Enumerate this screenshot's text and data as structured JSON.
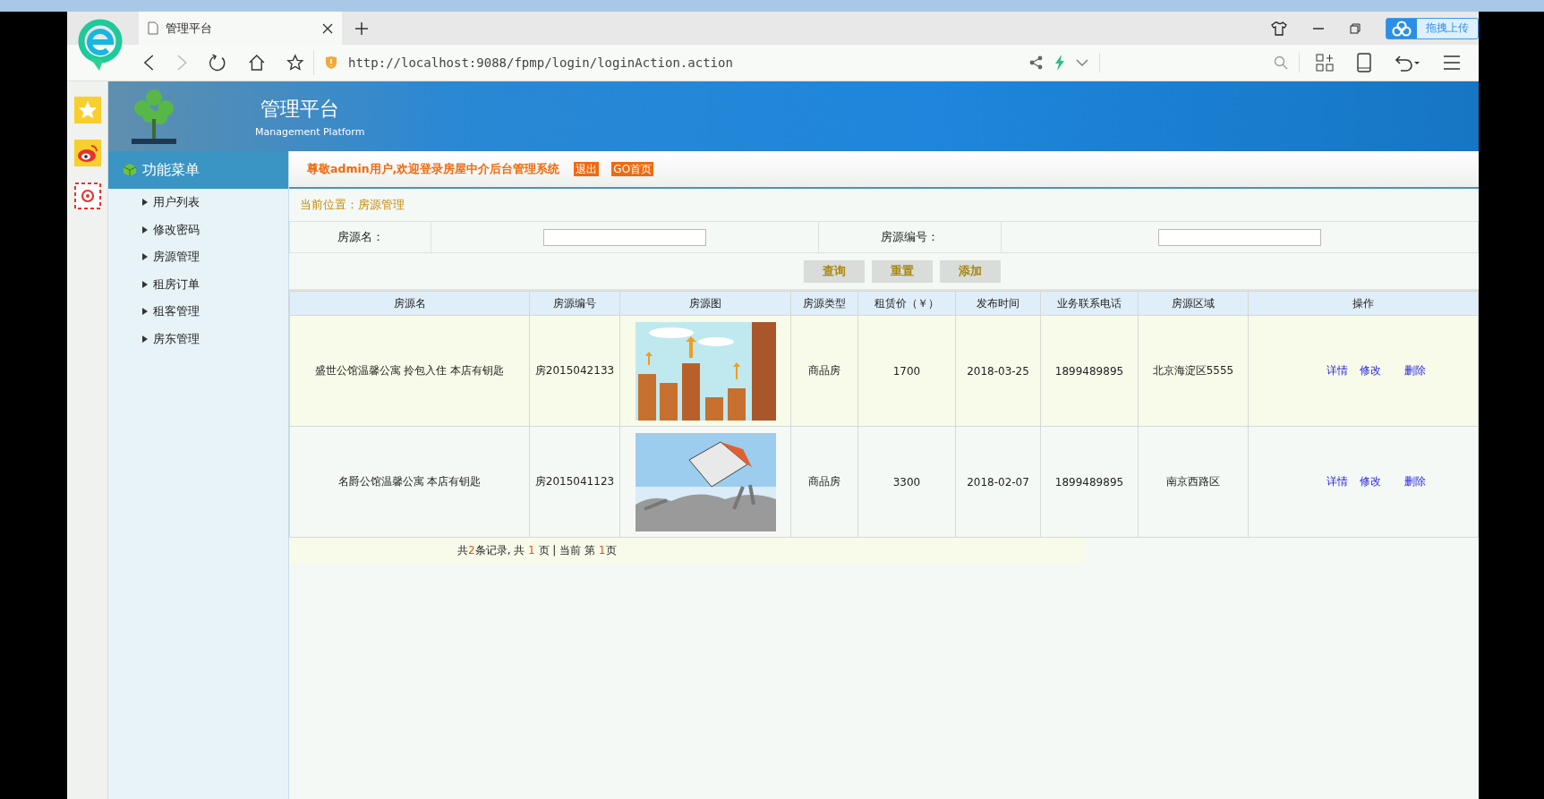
{
  "browser": {
    "tab_title": "管理平台",
    "url": "http://localhost:9088/fpmp/login/loginAction.action",
    "upload_button": "拖拽上传"
  },
  "header": {
    "title": "管理平台",
    "subtitle": "Management Platform"
  },
  "menu": {
    "title": "功能菜单",
    "items": [
      "用户列表",
      "修改密码",
      "房源管理",
      "租房订单",
      "租客管理",
      "房东管理"
    ]
  },
  "welcome": {
    "text": "尊敬admin用户,欢迎登录房屋中介后台管理系统",
    "buttons": [
      "退出",
      "GO首页"
    ]
  },
  "breadcrumb": "当前位置：房源管理",
  "search": {
    "fields": [
      {
        "label": "房源名："
      },
      {
        "label": "房源编号："
      }
    ],
    "buttons": [
      "查询",
      "重置",
      "添加"
    ]
  },
  "table": {
    "columns": [
      "房源名",
      "房源编号",
      "房源图",
      "房源类型",
      "租赁价（￥）",
      "发布时间",
      "业务联系电话",
      "房源区域",
      "操作"
    ],
    "rows": [
      {
        "name": "盛世公馆温馨公寓 拎包入住 本店有钥匙",
        "code": "房2015042133",
        "type": "商品房",
        "price": "1700",
        "date": "2018-03-25",
        "phone": "1899489895",
        "region": "北京海淀区5555",
        "actions": [
          "详情",
          "修改",
          "删除"
        ]
      },
      {
        "name": "名爵公馆温馨公寓 本店有钥匙",
        "code": "房2015041123",
        "type": "商品房",
        "price": "3300",
        "date": "2018-02-07",
        "phone": "1899489895",
        "region": "南京西路区",
        "actions": [
          "详情",
          "修改",
          "删除"
        ]
      }
    ]
  },
  "pager": [
    {
      "text": "共",
      "kind": "plain"
    },
    {
      "text": "2",
      "kind": "number"
    },
    {
      "text": "条记录, 共 ",
      "kind": "plain"
    },
    {
      "text": "1",
      "kind": "number"
    },
    {
      "text": " 页 | 当前 第 ",
      "kind": "plain"
    },
    {
      "text": "1",
      "kind": "number"
    },
    {
      "text": "页",
      "kind": "plain"
    }
  ]
}
